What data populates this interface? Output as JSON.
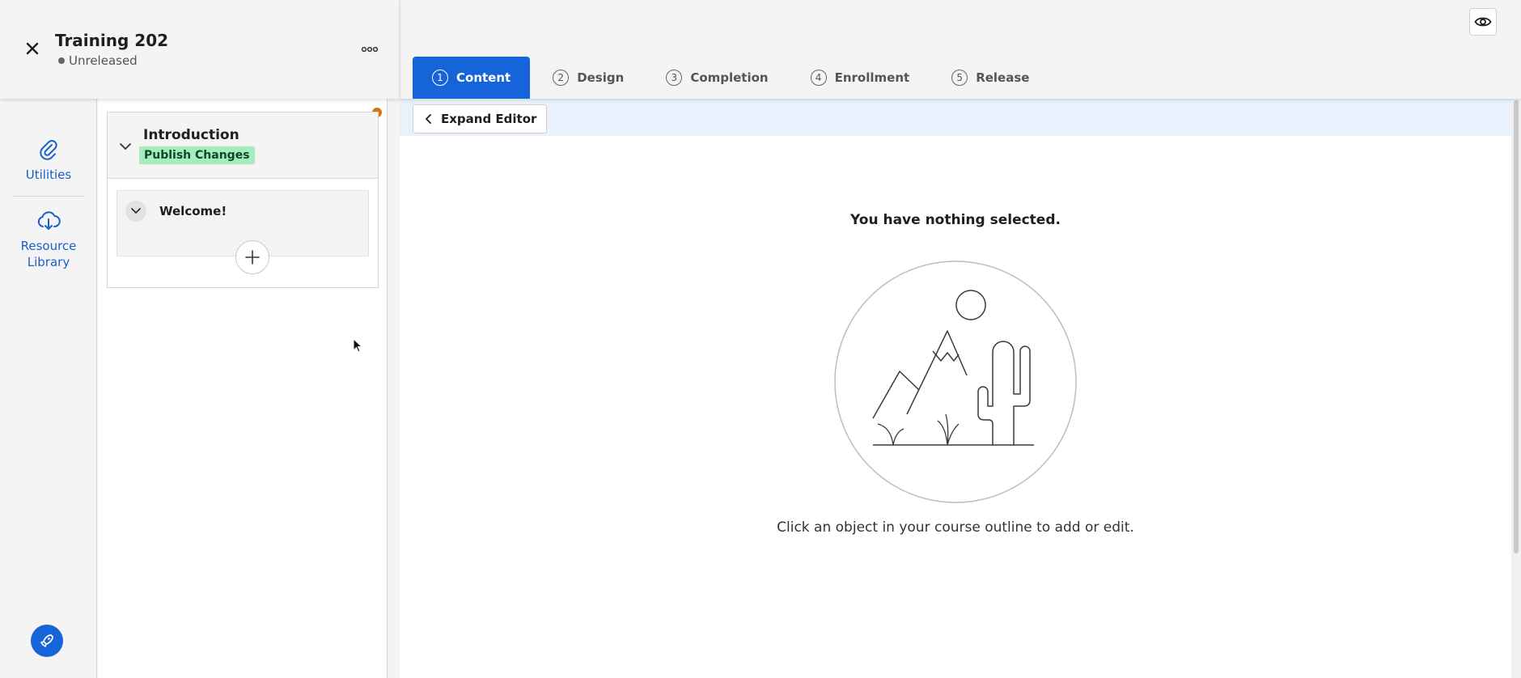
{
  "header": {
    "title": "Training 202",
    "status": "Unreleased"
  },
  "tabs": [
    {
      "num": "1",
      "label": "Content"
    },
    {
      "num": "2",
      "label": "Design"
    },
    {
      "num": "3",
      "label": "Completion"
    },
    {
      "num": "4",
      "label": "Enrollment"
    },
    {
      "num": "5",
      "label": "Release"
    }
  ],
  "rail": {
    "utilities": "Utilities",
    "resource_library_line1": "Resource",
    "resource_library_line2": "Library"
  },
  "outline": {
    "section_title": "Introduction",
    "badge": "Publish Changes",
    "lesson_title": "Welcome!"
  },
  "editor": {
    "expand_label": "Expand Editor",
    "empty_title": "You have nothing selected.",
    "empty_hint": "Click an object in your course outline to add or edit."
  },
  "colors": {
    "accent": "#1664d9",
    "badge_bg": "#a6ecc0",
    "unsaved_dot": "#d9750f"
  }
}
